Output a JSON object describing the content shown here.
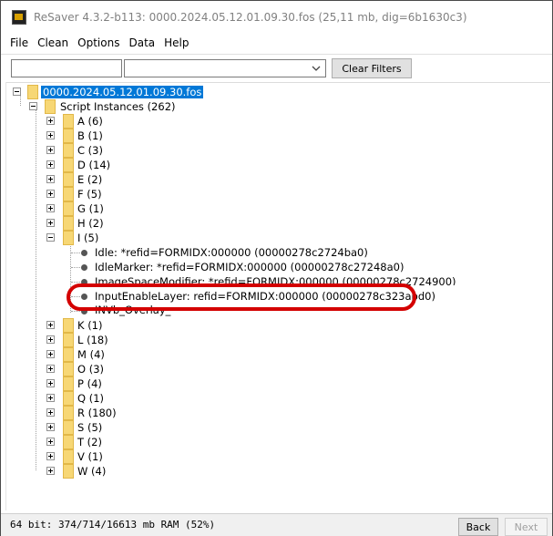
{
  "window": {
    "title": "ReSaver 4.3.2-b113: 0000.2024.05.12.01.09.30.fos (25,11 mb, dig=6b1630c3)"
  },
  "menu": [
    {
      "label": "File"
    },
    {
      "label": "Clean"
    },
    {
      "label": "Options"
    },
    {
      "label": "Data"
    },
    {
      "label": "Help"
    }
  ],
  "toolbar": {
    "filter_value": "",
    "combo_value": "",
    "clear_label": "Clear Filters"
  },
  "tree": {
    "root": "0000.2024.05.12.01.09.30.fos",
    "script_instances": "Script Instances (262)",
    "groups_before": [
      {
        "label": "A (6)"
      },
      {
        "label": "B (1)"
      },
      {
        "label": "C (3)"
      },
      {
        "label": "D (14)"
      },
      {
        "label": "E (2)"
      },
      {
        "label": "F (5)"
      },
      {
        "label": "G (1)"
      },
      {
        "label": "H (2)"
      }
    ],
    "expanded_group": "I (5)",
    "expanded_items": [
      {
        "label": "Idle: *refid=FORMIDX:000000 (00000278c2724ba0)"
      },
      {
        "label": "IdleMarker: *refid=FORMIDX:000000 (00000278c27248a0)"
      },
      {
        "label": "ImageSpaceModifier: *refid=FORMIDX:000000 (00000278c2724900)"
      },
      {
        "label": "InputEnableLayer: refid=FORMIDX:000000 (00000278c323abd0)"
      },
      {
        "label": "INVb_Overlay_"
      }
    ],
    "groups_after": [
      {
        "label": "K (1)"
      },
      {
        "label": "L (18)"
      },
      {
        "label": "M (4)"
      },
      {
        "label": "O (3)"
      },
      {
        "label": "P (4)"
      },
      {
        "label": "Q (1)"
      },
      {
        "label": "R (180)"
      },
      {
        "label": "S (5)"
      },
      {
        "label": "T (2)"
      },
      {
        "label": "V (1)"
      },
      {
        "label": "W (4)"
      }
    ]
  },
  "status": {
    "memory": "64 bit: 374/714/16613 mb RAM (52%)",
    "back_label": "Back",
    "next_label": "Next"
  },
  "colors": {
    "selection": "#0078d7",
    "annotation": "#d40000"
  }
}
